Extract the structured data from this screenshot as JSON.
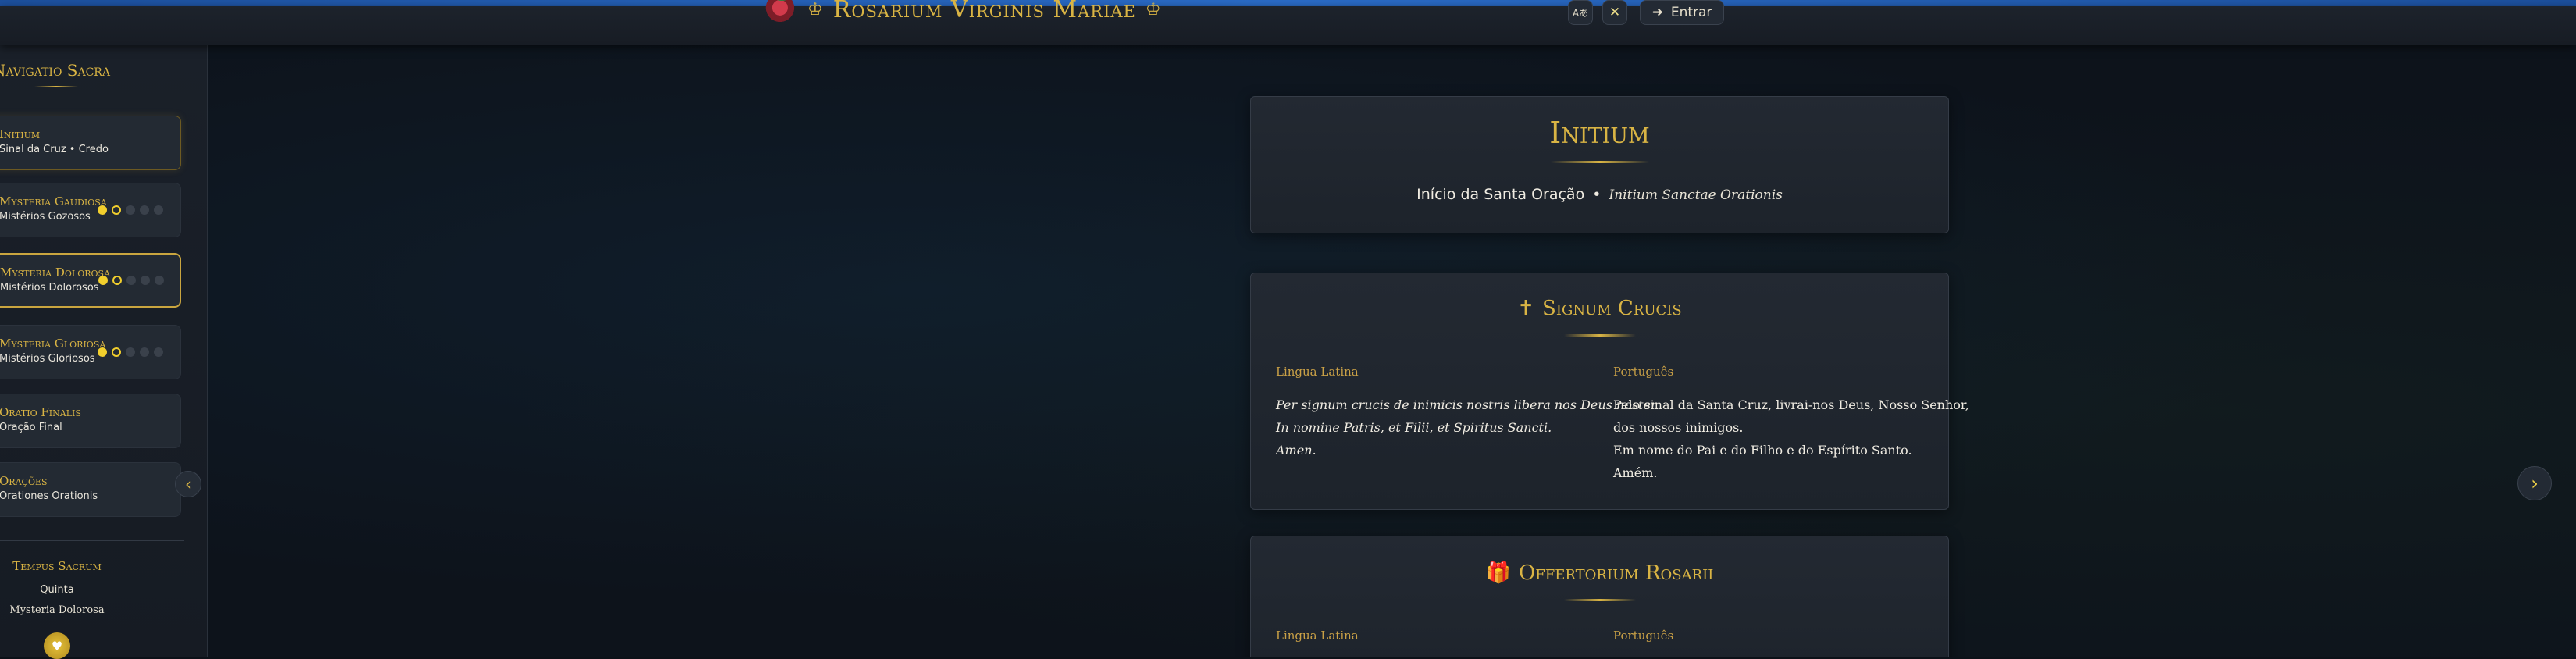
{
  "header": {
    "title": "Rosarium Virginis Mariae",
    "language_label": "Aあ",
    "login_label": "Entrar"
  },
  "sidebar": {
    "title": "Navigatio Sacra",
    "items": [
      {
        "latin": "Initium",
        "pt": "Sinal da Cruz • Credo"
      },
      {
        "latin": "Mysteria Gaudiosa",
        "pt": "Mistérios Gozosos"
      },
      {
        "latin": "Mysteria Dolorosa",
        "pt": "Mistérios Dolorosos"
      },
      {
        "latin": "Mysteria Gloriosa",
        "pt": "Mistérios Gloriosos"
      },
      {
        "latin": "Oratio Finalis",
        "pt": "Oração Final"
      },
      {
        "latin": "Orações",
        "pt": "Orationes Orationis"
      }
    ],
    "tempus": {
      "title": "Tempus Sacrum",
      "day": "Quinta",
      "mystery": "Mysteria Dolorosa"
    }
  },
  "main": {
    "initium": {
      "title": "Initium",
      "subtitle_pt": "Início da Santa Oração",
      "separator": "•",
      "subtitle_la": "Initium Sanctae Orationis"
    },
    "signum": {
      "title": "Signum Crucis",
      "label_la": "Lingua Latina",
      "label_pt": "Português",
      "latin_lines": [
        "Per signum crucis de inimicis nostris libera nos Deus noster.",
        "In nomine Patris, et Filii, et Spiritus Sancti.",
        "Amen."
      ],
      "pt_lines": [
        "Pelo sinal da Santa Cruz, livrai-nos Deus, Nosso Senhor,",
        "dos nossos inimigos.",
        "Em nome do Pai e do Filho e do Espírito Santo.",
        "Amém."
      ]
    },
    "offertorium": {
      "title": "Offertorium Rosarii",
      "label_la": "Lingua Latina",
      "label_pt": "Português"
    }
  },
  "colors": {
    "accent_gold": "#d9b444",
    "dot_active": "#f2cf2d",
    "top_bar_blue": "#2a6bc6"
  }
}
